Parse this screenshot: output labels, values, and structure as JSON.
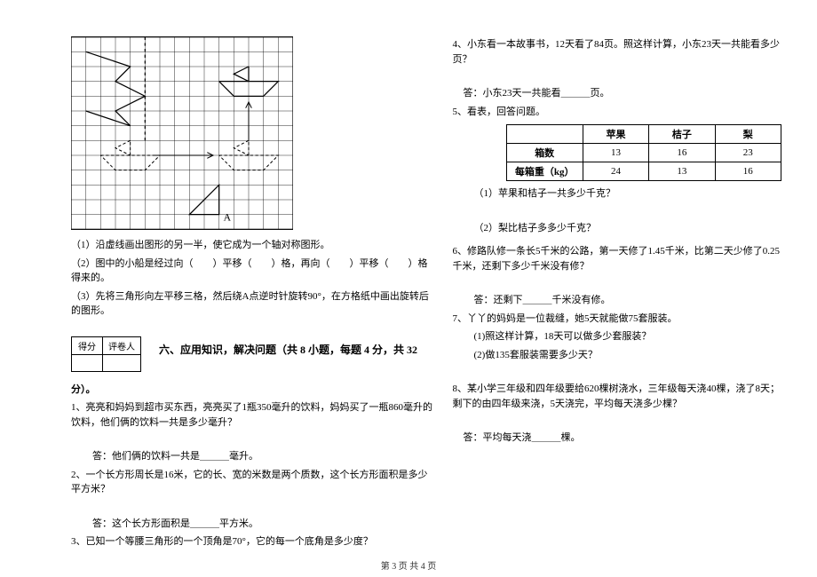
{
  "left": {
    "subq1": "（1）沿虚线画出图形的另一半，使它成为一个轴对称图形。",
    "subq2": "（2）图中的小船是经过向（　　）平移（　　）格，再向（　　）平移（　　）格得来的。",
    "subq3": "（3）先将三角形向左平移三格，然后绕A点逆时针旋转90°，在方格纸中画出旋转后的图形。",
    "score_left_label": "得分",
    "score_right_label": "评卷人",
    "section_title": "六、应用知识，解决问题（共 8 小题，每题 4 分，共 32",
    "section_title_tail": "分）。",
    "q1": "1、亮亮和妈妈到超市买东西，亮亮买了1瓶350毫升的饮料，妈妈买了一瓶860毫升的饮料，他们俩的饮料一共是多少毫升？",
    "q1_ans": "答：他们俩的饮料一共是＿＿＿毫升。",
    "q2": "2、一个长方形周长是16米，它的长、宽的米数是两个质数，这个长方形面积是多少平方米？",
    "q2_ans": "答：这个长方形面积是＿＿＿平方米。",
    "q3": "3、已知一个等腰三角形的一个顶角是70°，它的每一个底角是多少度？"
  },
  "right": {
    "q4": "4、小东看一本故事书，12天看了84页。照这样计算，小东23天一共能看多少页？",
    "q4_ans": "答：小东23天一共能看＿＿＿页。",
    "q5": "5、看表，回答问题。",
    "table": {
      "headers": [
        "",
        "苹果",
        "桔子",
        "梨"
      ],
      "rows": [
        {
          "label": "箱数",
          "vals": [
            "13",
            "16",
            "23"
          ]
        },
        {
          "label": "每箱重（kg）",
          "vals": [
            "24",
            "13",
            "16"
          ]
        }
      ]
    },
    "q5_sub1": "（1）苹果和桔子一共多少千克？",
    "q5_sub2": "（2）梨比桔子多多少千克？",
    "q6": "6、修路队修一条长5千米的公路，第一天修了1.45千米，比第二天少修了0.25千米，还剩下多少千米没有修？",
    "q6_ans": "答：还剩下＿＿＿千米没有修。",
    "q7": "7、丫丫的妈妈是一位裁缝，她5天就能做75套服装。",
    "q7_sub1": "(1)照这样计算，18天可以做多少套服装？",
    "q7_sub2": "(2)做135套服装需要多少天？",
    "q8": "8、某小学三年级和四年级要给620棵树浇水，三年级每天浇40棵，浇了8天；剩下的由四年级来浇，5天浇完，平均每天浇多少棵？",
    "q8_ans": "答：平均每天浇＿＿＿棵。"
  },
  "footer": "第 3 页  共 4 页",
  "grid": {
    "a_label": "A"
  }
}
